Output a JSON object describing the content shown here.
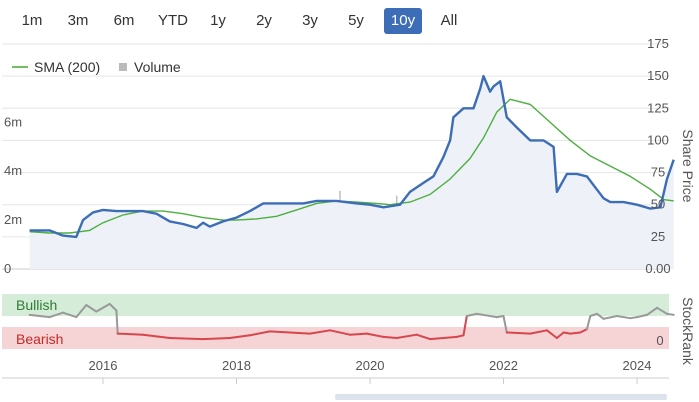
{
  "range_buttons": [
    {
      "label": "1m",
      "active": false
    },
    {
      "label": "3m",
      "active": false
    },
    {
      "label": "6m",
      "active": false
    },
    {
      "label": "YTD",
      "active": false
    },
    {
      "label": "1y",
      "active": false
    },
    {
      "label": "2y",
      "active": false
    },
    {
      "label": "3y",
      "active": false
    },
    {
      "label": "5y",
      "active": false
    },
    {
      "label": "10y",
      "active": true
    },
    {
      "label": "All",
      "active": false
    }
  ],
  "colors": {
    "price": "#3c6db6",
    "sma": "#4caf3f",
    "volume": "#bbbbbb",
    "area": "#eef2f8",
    "bullish_band": "#d5ecd8",
    "bearish_band": "#f6d3d5",
    "bullish_text": "#2e7d32",
    "bearish_text": "#c62828",
    "rank_bull": "#999999",
    "rank_bear": "#d6474d"
  },
  "chart_data": [
    {
      "type": "line",
      "legend": [
        "SMA (200)",
        "Volume"
      ],
      "x_ticks": [
        "2016",
        "2018",
        "2020",
        "2022",
        "2024"
      ],
      "y_right_title": "Share Price",
      "y_right_ticks": [
        "175",
        "150",
        "125",
        "100",
        "75",
        "50",
        "25",
        "0.00"
      ],
      "y_right_range": [
        0,
        175
      ],
      "y_left_ticks": [
        "6m",
        "4m",
        "2m",
        "0"
      ],
      "y_left_range": [
        0,
        9
      ],
      "grid": true,
      "series": [
        {
          "name": "Share Price",
          "x": [
            2014.9,
            2015.2,
            2015.4,
            2015.6,
            2015.7,
            2015.85,
            2016.0,
            2016.2,
            2016.4,
            2016.6,
            2016.8,
            2017.0,
            2017.2,
            2017.4,
            2017.5,
            2017.6,
            2017.8,
            2018.0,
            2018.2,
            2018.4,
            2018.6,
            2018.8,
            2019.0,
            2019.2,
            2019.5,
            2019.8,
            2020.0,
            2020.2,
            2020.45,
            2020.6,
            2020.8,
            2020.95,
            2021.1,
            2021.2,
            2021.25,
            2021.4,
            2021.55,
            2021.65,
            2021.7,
            2021.8,
            2021.85,
            2021.95,
            2022.05,
            2022.2,
            2022.4,
            2022.6,
            2022.75,
            2022.8,
            2022.95,
            2023.1,
            2023.25,
            2023.5,
            2023.6,
            2023.8,
            2024.0,
            2024.2,
            2024.35,
            2024.45,
            2024.55
          ],
          "y": [
            30,
            30,
            26,
            25,
            38,
            44,
            46,
            45,
            45,
            45,
            43,
            37,
            35,
            32,
            36,
            33,
            37,
            40,
            45,
            51,
            51,
            51,
            51,
            53,
            53,
            51,
            50,
            48,
            50,
            60,
            67,
            72,
            87,
            100,
            118,
            125,
            125,
            140,
            150,
            138,
            142,
            146,
            118,
            110,
            100,
            100,
            95,
            60,
            74,
            74,
            72,
            55,
            52,
            52,
            50,
            47,
            48,
            70,
            85
          ]
        },
        {
          "name": "SMA (200)",
          "x": [
            2014.9,
            2015.2,
            2015.5,
            2015.8,
            2016.0,
            2016.3,
            2016.6,
            2016.9,
            2017.2,
            2017.5,
            2017.8,
            2018.0,
            2018.3,
            2018.6,
            2018.9,
            2019.2,
            2019.5,
            2019.8,
            2020.1,
            2020.3,
            2020.6,
            2020.9,
            2021.2,
            2021.5,
            2021.7,
            2021.9,
            2022.1,
            2022.4,
            2022.7,
            2023.0,
            2023.3,
            2023.6,
            2023.9,
            2024.2,
            2024.4,
            2024.55
          ],
          "y": [
            29,
            28,
            28,
            30,
            36,
            42,
            45,
            45,
            43,
            40,
            38,
            38,
            39,
            41,
            46,
            51,
            53,
            52,
            51,
            50,
            52,
            58,
            70,
            86,
            102,
            122,
            132,
            128,
            114,
            100,
            88,
            80,
            72,
            62,
            54,
            53
          ]
        },
        {
          "name": "Volume",
          "x": [
            2015.0,
            2015.4,
            2015.8,
            2016.2,
            2016.6,
            2017.0,
            2017.4,
            2017.8,
            2018.2,
            2018.6,
            2019.0,
            2019.4,
            2019.55,
            2019.8,
            2020.1,
            2020.4,
            2020.7,
            2021.0,
            2021.3,
            2021.6,
            2021.75,
            2021.9,
            2022.1,
            2022.35,
            2022.6,
            2022.9,
            2023.1,
            2023.3,
            2023.45,
            2023.6,
            2023.9,
            2024.2,
            2024.45
          ],
          "y": [
            0.6,
            1.1,
            0.5,
            0.7,
            0.4,
            0.6,
            0.9,
            0.5,
            1.2,
            0.5,
            0.7,
            0.6,
            3.2,
            0.6,
            1.0,
            3.0,
            0.8,
            0.7,
            0.9,
            1.5,
            1.2,
            1.0,
            1.3,
            2.2,
            1.2,
            1.5,
            1.6,
            1.4,
            2.0,
            0.7,
            0.6,
            0.7,
            0.9
          ]
        }
      ]
    },
    {
      "type": "line",
      "y_right_title": "StockRank",
      "y_right_ticks": [
        "0"
      ],
      "bands": [
        "Bullish",
        "Bearish"
      ],
      "grid": false,
      "series": [
        {
          "name": "StockRank",
          "x": [
            2014.9,
            2015.2,
            2015.4,
            2015.6,
            2015.75,
            2015.9,
            2016.1,
            2016.2,
            2016.22,
            2016.6,
            2017.0,
            2017.5,
            2017.9,
            2018.2,
            2018.5,
            2018.8,
            2019.1,
            2019.4,
            2019.7,
            2019.95,
            2020.2,
            2020.4,
            2020.7,
            2020.9,
            2021.1,
            2021.3,
            2021.4,
            2021.45,
            2021.6,
            2021.9,
            2022.0,
            2022.05,
            2022.4,
            2022.65,
            2022.8,
            2022.9,
            2023.0,
            2023.15,
            2023.25,
            2023.3,
            2023.4,
            2023.5,
            2023.7,
            2023.9,
            2024.0,
            2024.15,
            2024.3,
            2024.45,
            2024.55
          ],
          "y": [
            62,
            58,
            66,
            58,
            80,
            68,
            82,
            70,
            28,
            26,
            20,
            18,
            20,
            25,
            32,
            30,
            28,
            34,
            26,
            28,
            22,
            20,
            26,
            18,
            20,
            22,
            25,
            60,
            64,
            58,
            60,
            30,
            28,
            34,
            20,
            30,
            28,
            30,
            36,
            60,
            64,
            55,
            60,
            56,
            58,
            62,
            75,
            64,
            62
          ]
        }
      ]
    }
  ]
}
